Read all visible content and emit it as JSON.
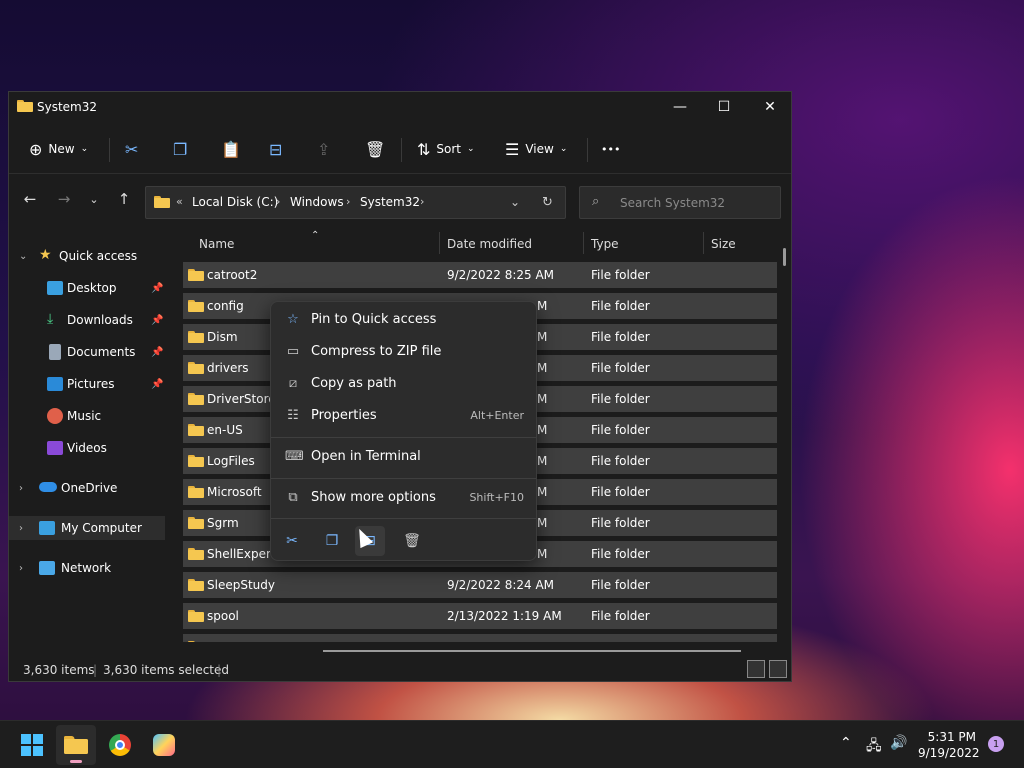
{
  "window": {
    "title": "System32"
  },
  "toolbar": {
    "new_label": "New",
    "sort_label": "Sort",
    "view_label": "View",
    "more_label": "•••"
  },
  "address": {
    "prefix": "«",
    "crumbs": [
      "Local Disk (C:)",
      "Windows",
      "System32"
    ],
    "sep": "›"
  },
  "search": {
    "placeholder": "Search System32"
  },
  "sidebar": {
    "items": [
      {
        "label": "Quick access"
      },
      {
        "label": "Desktop"
      },
      {
        "label": "Downloads"
      },
      {
        "label": "Documents"
      },
      {
        "label": "Pictures"
      },
      {
        "label": "Music"
      },
      {
        "label": "Videos"
      },
      {
        "label": "OneDrive"
      },
      {
        "label": "My Computer"
      },
      {
        "label": "Network"
      }
    ]
  },
  "columns": {
    "name": "Name",
    "date": "Date modified",
    "type": "Type",
    "size": "Size"
  },
  "files": [
    {
      "name": "catroot2",
      "date": "9/2/2022 8:25 AM",
      "type": "File folder"
    },
    {
      "name": "config",
      "date": "M",
      "type": "File folder"
    },
    {
      "name": "Dism",
      "date": "M",
      "type": "File folder"
    },
    {
      "name": "drivers",
      "date": "M",
      "type": "File folder"
    },
    {
      "name": "DriverStore",
      "date": "M",
      "type": "File folder"
    },
    {
      "name": "en-US",
      "date": "M",
      "type": "File folder"
    },
    {
      "name": "LogFiles",
      "date": "M",
      "type": "File folder"
    },
    {
      "name": "Microsoft",
      "date": "M",
      "type": "File folder"
    },
    {
      "name": "Sgrm",
      "date": "M",
      "type": "File folder"
    },
    {
      "name": "ShellExperie",
      "date": "M",
      "type": "File folder"
    },
    {
      "name": "SleepStudy",
      "date": "9/2/2022 8:24 AM",
      "type": "File folder"
    },
    {
      "name": "spool",
      "date": "2/13/2022 1:19 AM",
      "type": "File folder"
    }
  ],
  "status": {
    "count": "3,630 items",
    "selected": "3,630 items selected"
  },
  "context_menu": {
    "items": [
      {
        "label": "Pin to Quick access",
        "shortcut": ""
      },
      {
        "label": "Compress to ZIP file",
        "shortcut": ""
      },
      {
        "label": "Copy as path",
        "shortcut": ""
      },
      {
        "label": "Properties",
        "shortcut": "Alt+Enter"
      },
      {
        "label": "Open in Terminal",
        "shortcut": ""
      },
      {
        "label": "Show more options",
        "shortcut": "Shift+F10"
      }
    ]
  },
  "taskbar": {
    "time": "5:31 PM",
    "date": "9/19/2022",
    "notifications": "1"
  },
  "colors": {
    "accent": "#4cc2ff",
    "folder": "#f5c750",
    "row_selected": "#3f3f3f"
  }
}
